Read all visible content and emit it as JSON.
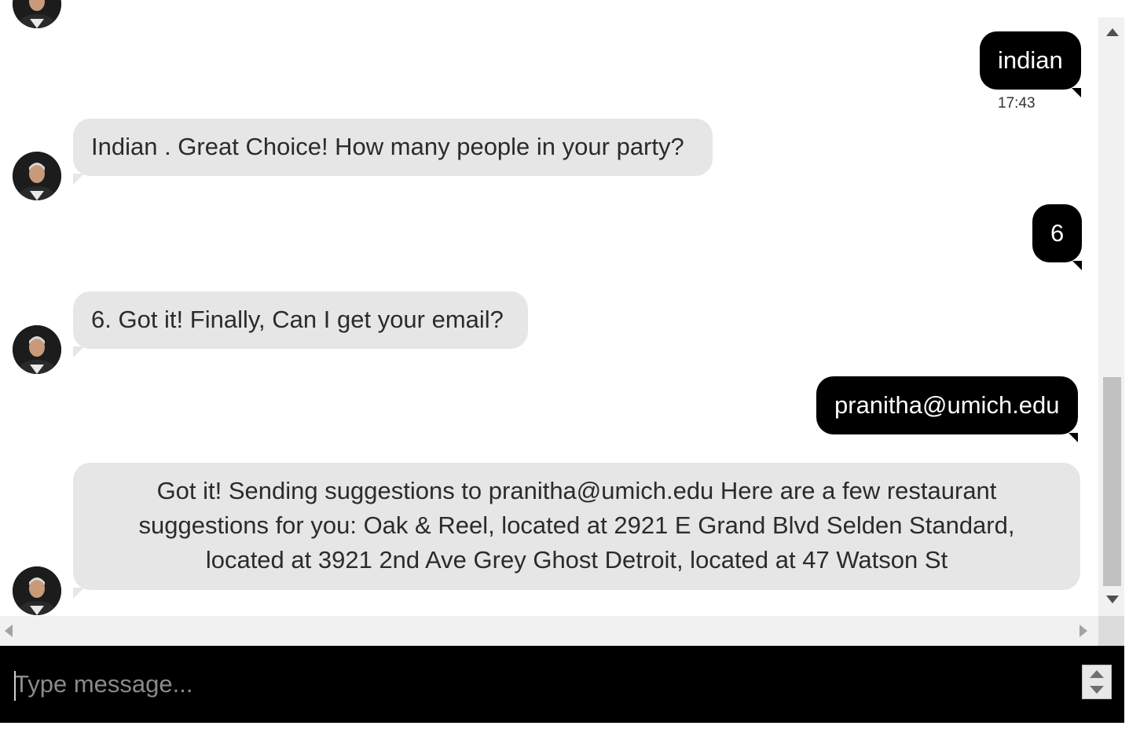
{
  "conversation": {
    "bot_avatar_icon": "user-portrait-icon",
    "messages": [
      {
        "sender": "user",
        "text": "indian",
        "time": "17:43"
      },
      {
        "sender": "bot",
        "text": "Indian . Great Choice! How many people in your party?"
      },
      {
        "sender": "user",
        "text": "6"
      },
      {
        "sender": "bot",
        "text": "6. Got it! Finally, Can I get your email?"
      },
      {
        "sender": "user",
        "text": "pranitha@umich.edu"
      },
      {
        "sender": "bot",
        "text": "Got it! Sending suggestions to pranitha@umich.edu Here are a few restaurant suggestions for you: Oak & Reel, located at 2921 E Grand Blvd Selden Standard, located at 3921 2nd Ave Grey Ghost Detroit, located at 47 Watson St"
      }
    ]
  },
  "composer": {
    "placeholder": "Type message...",
    "value": ""
  },
  "colors": {
    "user_bubble": "#000000",
    "bot_bubble": "#e6e6e6",
    "input_bar": "#000000"
  }
}
